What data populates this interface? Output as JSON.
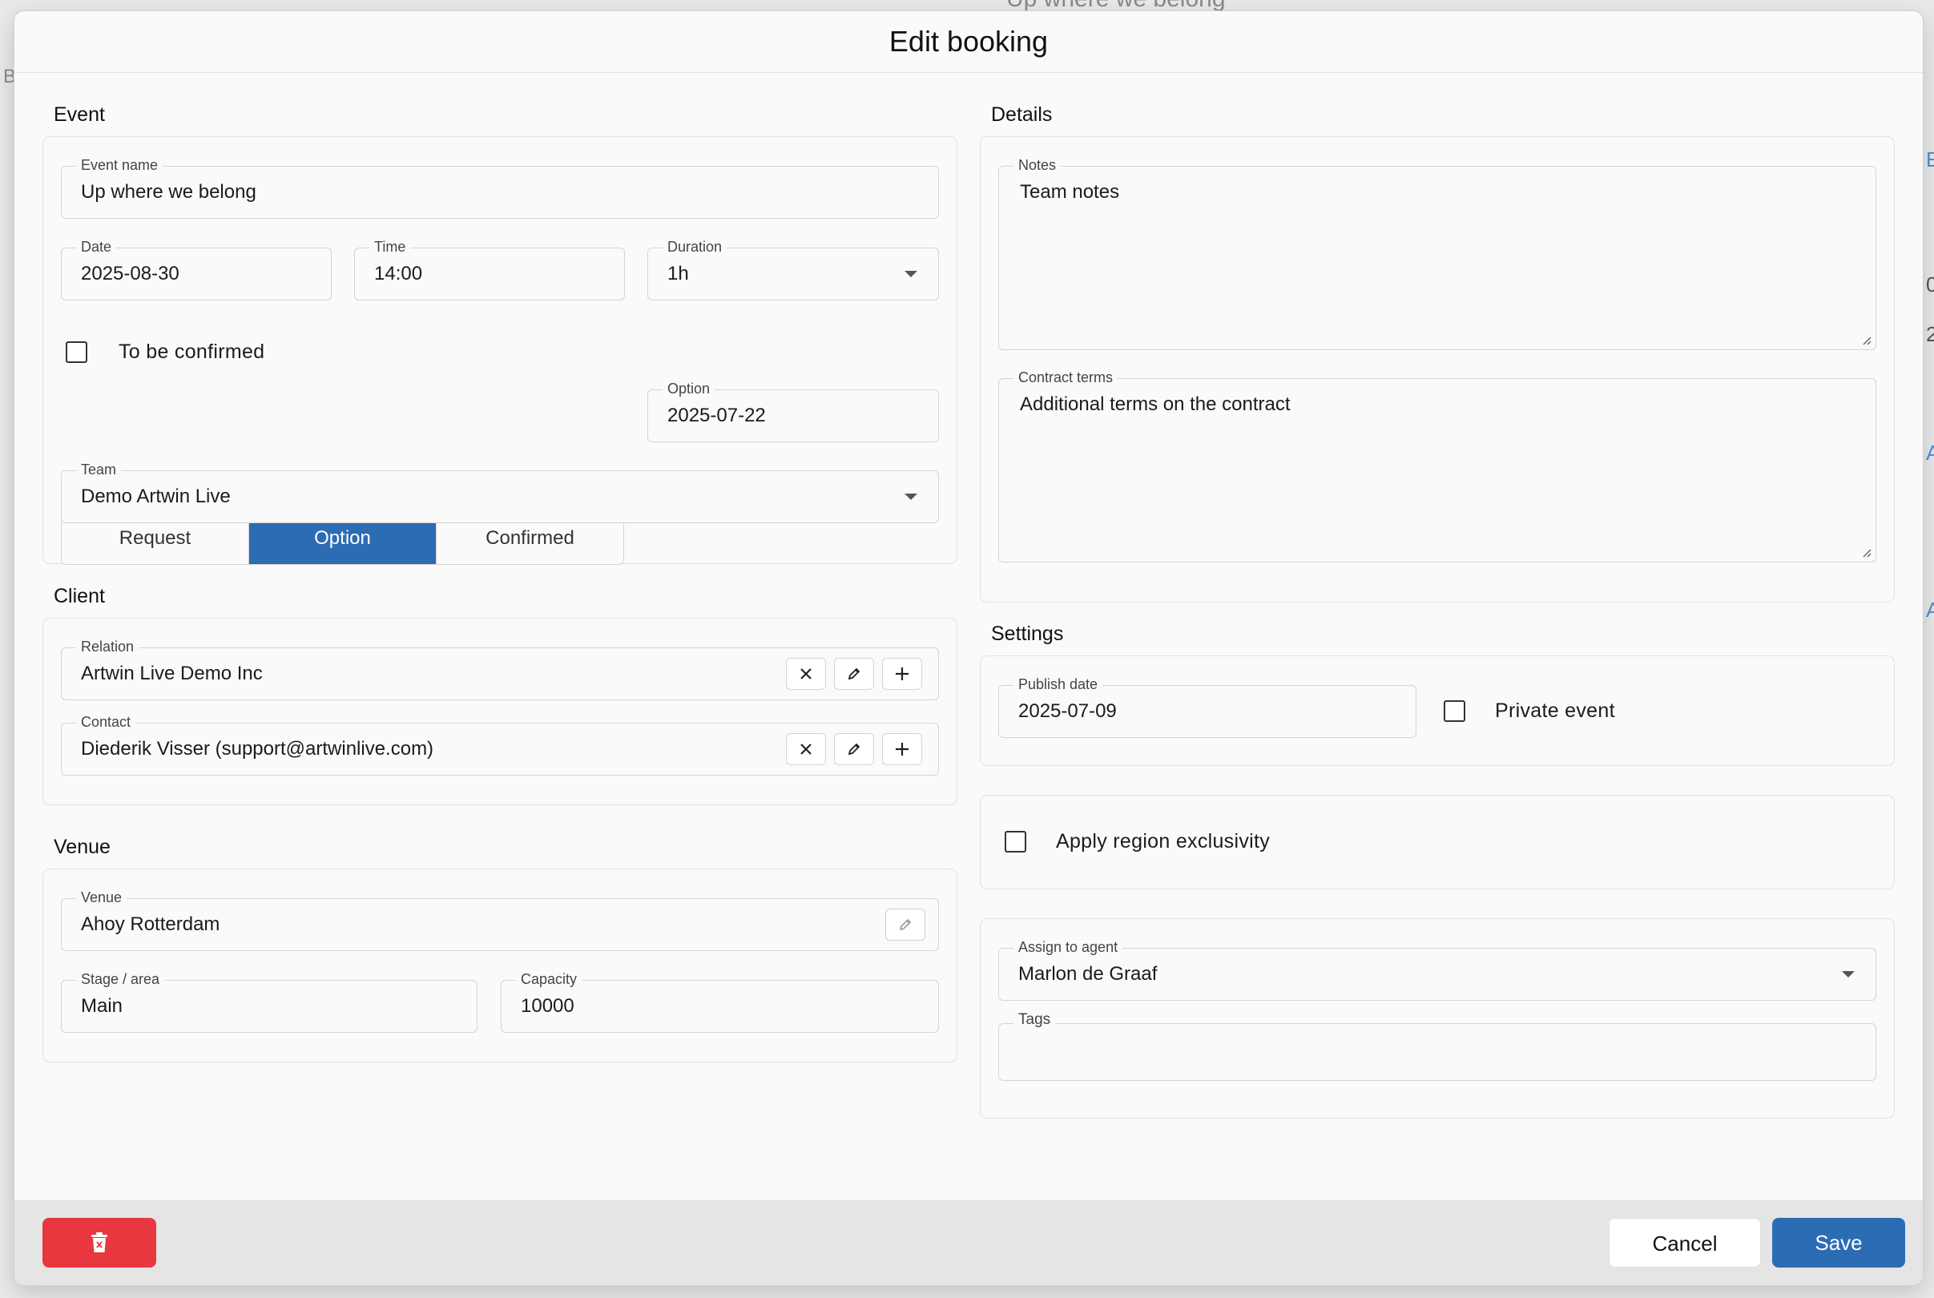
{
  "background": {
    "title_partial": "Up where we belong",
    "left_edge_text": "B",
    "right_edge_fragments": [
      "E",
      "0",
      "2",
      "A",
      "A"
    ]
  },
  "modal": {
    "title": "Edit booking"
  },
  "event": {
    "section_title": "Event",
    "event_name": {
      "label": "Event name",
      "value": "Up where we belong"
    },
    "date": {
      "label": "Date",
      "value": "2025-08-30"
    },
    "time": {
      "label": "Time",
      "value": "14:00"
    },
    "duration": {
      "label": "Duration",
      "value": "1h"
    },
    "to_be_confirmed": {
      "label": "To be confirmed",
      "checked": false
    },
    "status_options": [
      "Request",
      "Option",
      "Confirmed"
    ],
    "status_selected": "Option",
    "option_date": {
      "label": "Option",
      "value": "2025-07-22"
    },
    "team": {
      "label": "Team",
      "value": "Demo Artwin Live"
    }
  },
  "client": {
    "section_title": "Client",
    "relation": {
      "label": "Relation",
      "value": "Artwin Live Demo Inc"
    },
    "contact": {
      "label": "Contact",
      "value": "Diederik Visser (support@artwinlive.com)"
    }
  },
  "venue": {
    "section_title": "Venue",
    "venue": {
      "label": "Venue",
      "value": "Ahoy Rotterdam"
    },
    "stage": {
      "label": "Stage / area",
      "value": "Main"
    },
    "capacity": {
      "label": "Capacity",
      "value": "10000"
    }
  },
  "details": {
    "section_title": "Details",
    "notes": {
      "label": "Notes",
      "value": "Team notes"
    },
    "contract_terms": {
      "label": "Contract terms",
      "value": "Additional terms on the contract"
    }
  },
  "settings": {
    "section_title": "Settings",
    "publish_date": {
      "label": "Publish date",
      "value": "2025-07-09"
    },
    "private_event": {
      "label": "Private event",
      "checked": false
    }
  },
  "region": {
    "apply_region_exclusivity": {
      "label": "Apply region exclusivity",
      "checked": false
    }
  },
  "agent": {
    "assign": {
      "label": "Assign to agent",
      "value": "Marlon de Graaf"
    },
    "tags": {
      "label": "Tags",
      "value": ""
    }
  },
  "footer": {
    "delete_icon": "trash-icon",
    "cancel_label": "Cancel",
    "save_label": "Save"
  },
  "colors": {
    "primary": "#2b6cb5",
    "danger": "#e8373f"
  }
}
